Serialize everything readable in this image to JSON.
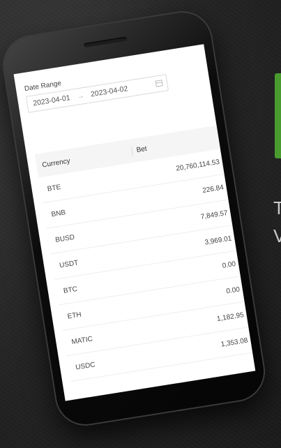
{
  "date_range": {
    "label": "Date Range",
    "start": "2023-04-01",
    "separator": "→",
    "end": "2023-04-02"
  },
  "table": {
    "headers": {
      "currency": "Currency",
      "bet": "Bet"
    },
    "rows": [
      {
        "currency": "BTE",
        "bet": "20,760,114.53"
      },
      {
        "currency": "BNB",
        "bet": "226.84"
      },
      {
        "currency": "BUSD",
        "bet": "7,849.57"
      },
      {
        "currency": "USDT",
        "bet": "3,969.01"
      },
      {
        "currency": "BTC",
        "bet": "0.00"
      },
      {
        "currency": "ETH",
        "bet": "0.00"
      },
      {
        "currency": "MATIC",
        "bet": "1,182.95"
      },
      {
        "currency": "USDC",
        "bet": "1,353.08"
      }
    ]
  },
  "side": {
    "line1": "T",
    "line2": "V"
  },
  "colors": {
    "accent_green": "#4a9b2f",
    "background": "#262626"
  }
}
